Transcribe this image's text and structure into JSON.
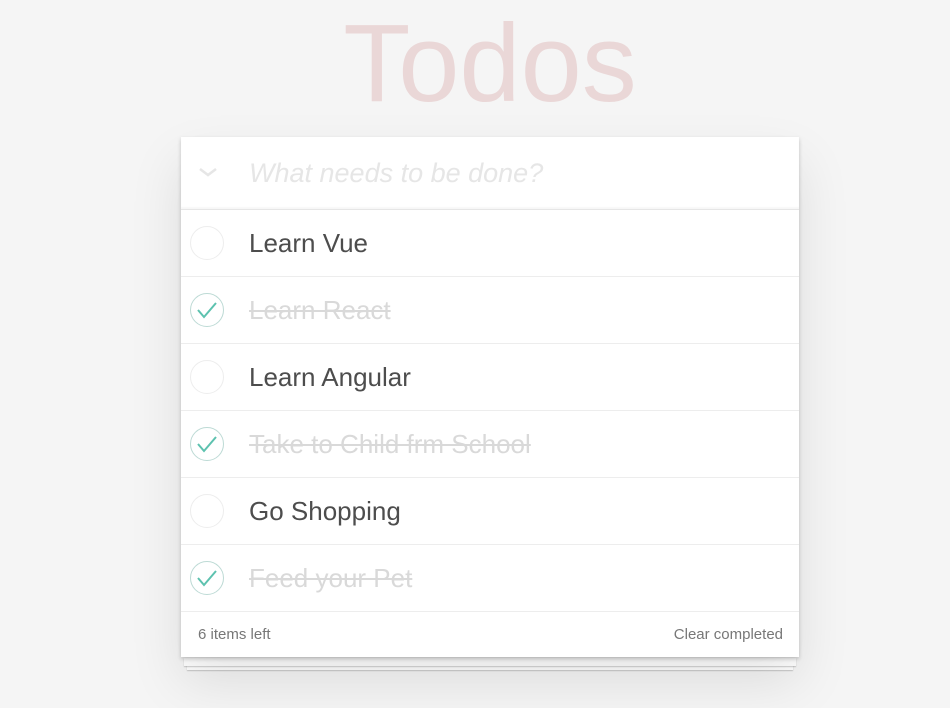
{
  "app": {
    "title": "Todos"
  },
  "new_todo": {
    "placeholder": "What needs to be done?"
  },
  "todos": [
    {
      "label": "Learn Vue",
      "completed": false
    },
    {
      "label": "Learn React",
      "completed": true
    },
    {
      "label": "Learn Angular",
      "completed": false
    },
    {
      "label": "Take to Child frm School",
      "completed": true
    },
    {
      "label": "Go Shopping",
      "completed": false
    },
    {
      "label": "Feed your Pet",
      "completed": true
    }
  ],
  "footer": {
    "items_left": "6 items left",
    "clear_completed": "Clear completed"
  },
  "colors": {
    "title": "#ead7d7",
    "check_done": "#5dc2af",
    "background": "#f5f5f5"
  }
}
